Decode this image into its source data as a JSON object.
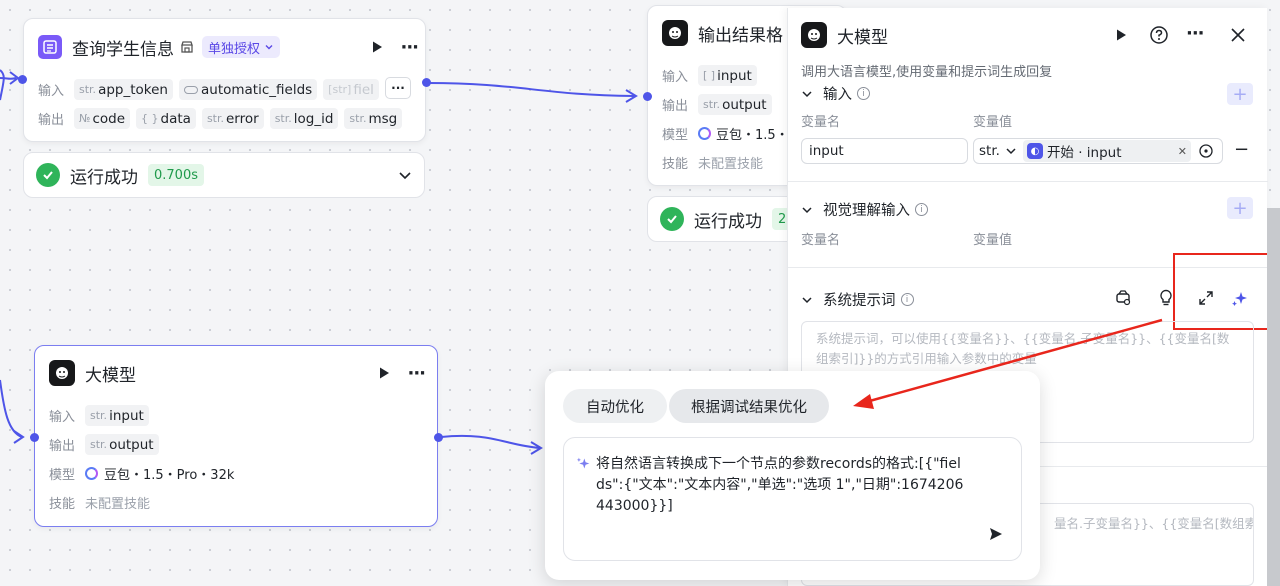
{
  "node_query": {
    "title": "查询学生信息",
    "badge": "单独授权",
    "input_label": "输入",
    "output_label": "输出",
    "inputs": [
      {
        "type": "str.",
        "name": "app_token"
      },
      {
        "type": "",
        "name": "automatic_fields"
      },
      {
        "type": "[str]",
        "name": "fiel"
      }
    ],
    "outputs": [
      {
        "type": "№",
        "name": "code"
      },
      {
        "type": "{ }",
        "name": "data"
      },
      {
        "type": "str.",
        "name": "error"
      },
      {
        "type": "str.",
        "name": "log_id"
      },
      {
        "type": "str.",
        "name": "msg"
      }
    ],
    "more": "···"
  },
  "status_1": {
    "text": "运行成功",
    "time": "0.700s"
  },
  "node_output": {
    "title": "输出结果格",
    "input_label": "输入",
    "output_label": "输出",
    "model_label": "模型",
    "skill_label": "技能",
    "input": {
      "type": "[ ]",
      "name": "input"
    },
    "output": {
      "type": "str.",
      "name": "output"
    },
    "model": "豆包・1.5・",
    "skill": "未配置技能"
  },
  "status_2": {
    "text": "运行成功",
    "time": "2"
  },
  "node_llm": {
    "title": "大模型",
    "input_label": "输入",
    "output_label": "输出",
    "model_label": "模型",
    "skill_label": "技能",
    "input": {
      "type": "str.",
      "name": "input"
    },
    "output": {
      "type": "str.",
      "name": "output"
    },
    "model": "豆包・1.5・Pro・32k",
    "skill": "未配置技能"
  },
  "panel": {
    "title": "大模型",
    "description": "调用大语言模型,使用变量和提示词生成回复",
    "input_section": "输入",
    "col_var_name": "变量名",
    "col_var_value": "变量值",
    "var_name_value": "input",
    "var_type": "str.",
    "var_ref": "开始 · input",
    "vision_section": "视觉理解输入",
    "vision_col_name": "变量名",
    "vision_col_value": "变量值",
    "system_prompt_section": "系统提示词",
    "system_prompt_placeholder": "系统提示词，可以使用{{变量名}}、{{变量名.子变量名}}、{{变量名[数组索引]}}的方式引用输入参数中的变量",
    "lower_box_text": "量名.子变量名}}、{{变量名[数组索"
  },
  "popup": {
    "btn_auto": "自动优化",
    "btn_debug": "根据调试结果优化",
    "prompt_text": "将自然语言转换成下一个节点的参数records的格式:[{\"fields\":{\"文本\":\"文本内容\",\"单选\":\"选项 1\",\"日期\":1674206443000}}]"
  },
  "colors": {
    "accent": "#4e55e8",
    "success": "#2fb45a",
    "annotation": "#e8261c",
    "brand_purple": "#7a5af8"
  }
}
